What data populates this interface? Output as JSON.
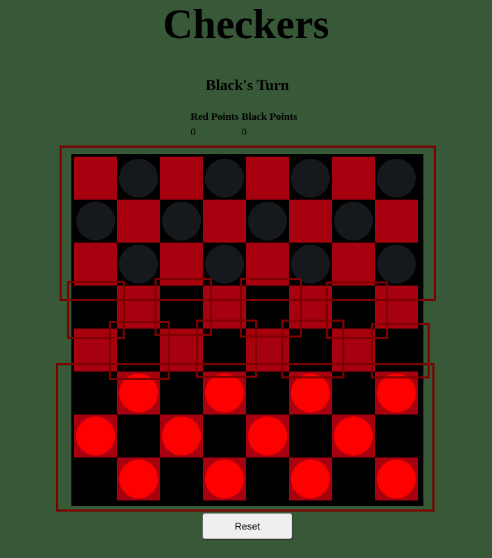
{
  "title": "Checkers",
  "turn_text": "Black's Turn",
  "scoreboard": {
    "red_label": "Red Points",
    "black_label": "Black Points",
    "red_points": "0",
    "black_points": "0"
  },
  "board": {
    "size": 8,
    "pieces": [
      [
        null,
        "black",
        null,
        "black",
        null,
        "black",
        null,
        "black"
      ],
      [
        "black",
        null,
        "black",
        null,
        "black",
        null,
        "black",
        null
      ],
      [
        null,
        "black",
        null,
        "black",
        null,
        "black",
        null,
        "black"
      ],
      [
        null,
        null,
        null,
        null,
        null,
        null,
        null,
        null
      ],
      [
        null,
        null,
        null,
        null,
        null,
        null,
        null,
        null
      ],
      [
        null,
        "red",
        null,
        "red",
        null,
        "red",
        null,
        "red"
      ],
      [
        "red",
        null,
        "red",
        null,
        "red",
        null,
        "red",
        null
      ],
      [
        null,
        "red",
        null,
        "red",
        null,
        "red",
        null,
        "red"
      ]
    ]
  },
  "colors": {
    "background": "#385937",
    "red_square": "#a7000f",
    "dark_square": "#000000",
    "black_piece": "#15181c",
    "red_piece": "#ff0000",
    "outline": "#7e0000"
  },
  "reset_label": "Reset"
}
